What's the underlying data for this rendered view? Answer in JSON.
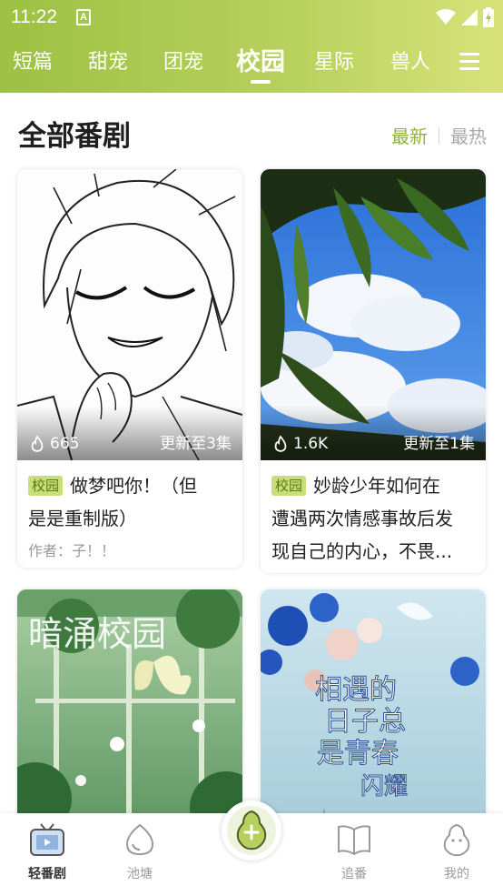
{
  "status_bar": {
    "time": "11:22",
    "badge": "A"
  },
  "tabs": [
    {
      "label": "短篇"
    },
    {
      "label": "甜宠"
    },
    {
      "label": "团宠"
    },
    {
      "label": "校园"
    },
    {
      "label": "星际"
    },
    {
      "label": "兽人"
    }
  ],
  "active_tab": "校园",
  "section": {
    "title": "全部番剧",
    "sort_new": "最新",
    "sort_hot": "最热"
  },
  "cards": [
    {
      "views": "665",
      "update": "更新至3集",
      "tag": "校园",
      "title_line1": "做梦吧你！（但",
      "title_line2": "是是重制版）",
      "author": "作者：子！！"
    },
    {
      "views": "1.6K",
      "update": "更新至1集",
      "tag": "校园",
      "title_line1": "妙龄少年如何在",
      "title_line2": "遭遇两次情感事故后发",
      "title_line3": "现自己的内心，不畏..."
    },
    {
      "cover_text": "暗涌校园"
    },
    {
      "cover_text_1": "相遇的",
      "cover_text_2": "日子总",
      "cover_text_3": "是青春",
      "cover_text_4": "闪耀"
    }
  ],
  "bottom_nav": [
    {
      "label": "轻番剧"
    },
    {
      "label": "池塘"
    },
    {
      "label": "追番"
    },
    {
      "label": "我的"
    }
  ],
  "colors": {
    "accent": "#8fb33c",
    "tag_bg": "#c8de7b",
    "header_start": "#9cc143",
    "header_end": "#d7e37a"
  }
}
